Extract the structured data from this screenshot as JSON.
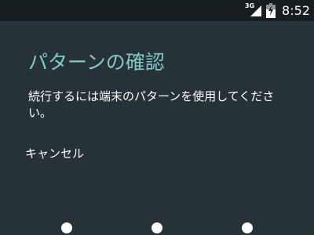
{
  "status_bar": {
    "network_type": "3G",
    "signal_icon": "cell-signal-icon",
    "battery_icon": "battery-charging-icon",
    "time": "8:52"
  },
  "dialog": {
    "title": "パターンの確認",
    "message": "続行するには端末のパターンを使用してください。",
    "cancel_label": "キャンセル"
  },
  "pattern": {
    "dots_visible": 3
  },
  "colors": {
    "background": "#263238",
    "status_bar": "#161e22",
    "title_accent": "#80cbc4",
    "text": "#ffffff"
  }
}
